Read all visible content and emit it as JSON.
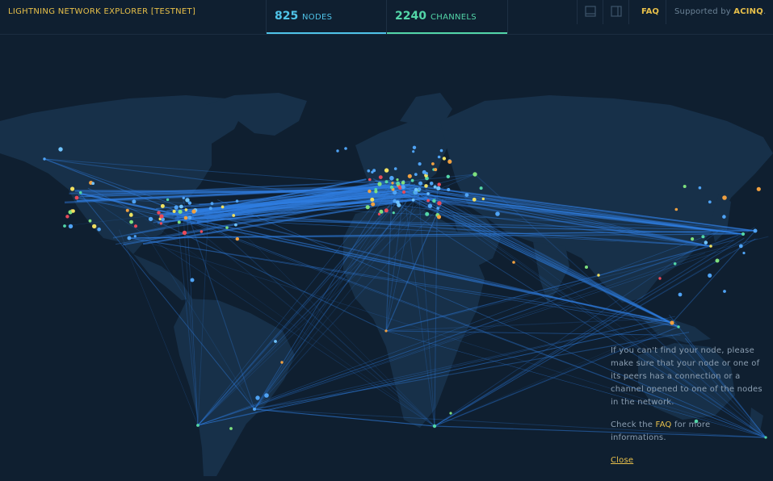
{
  "header": {
    "title": "LIGHTNING NETWORK EXPLORER [TESTNET]",
    "nodes_count": "825",
    "nodes_label": "NODES",
    "channels_count": "2240",
    "channels_label": "CHANNELS",
    "faq_label": "FAQ",
    "supported_prefix": "Supported by ",
    "supported_brand": "ACINQ",
    "supported_suffix": "."
  },
  "info_panel": {
    "message": "If you can't find your node, please make sure that your node or one of its peers has a connection or a channel opened to one of the nodes in the network.",
    "check_prefix": "Check the ",
    "check_link": "FAQ",
    "check_suffix": " for more informations.",
    "close_label": "Close"
  },
  "colors": {
    "background": "#0f1f30",
    "land": "#173049",
    "edge": "#2f7de0",
    "accent_yellow": "#e8c04a",
    "nodes_accent": "#4fc3e8",
    "channels_accent": "#53d6a8"
  },
  "icons": [
    "panel-toggle-icon",
    "sidebar-toggle-icon"
  ]
}
